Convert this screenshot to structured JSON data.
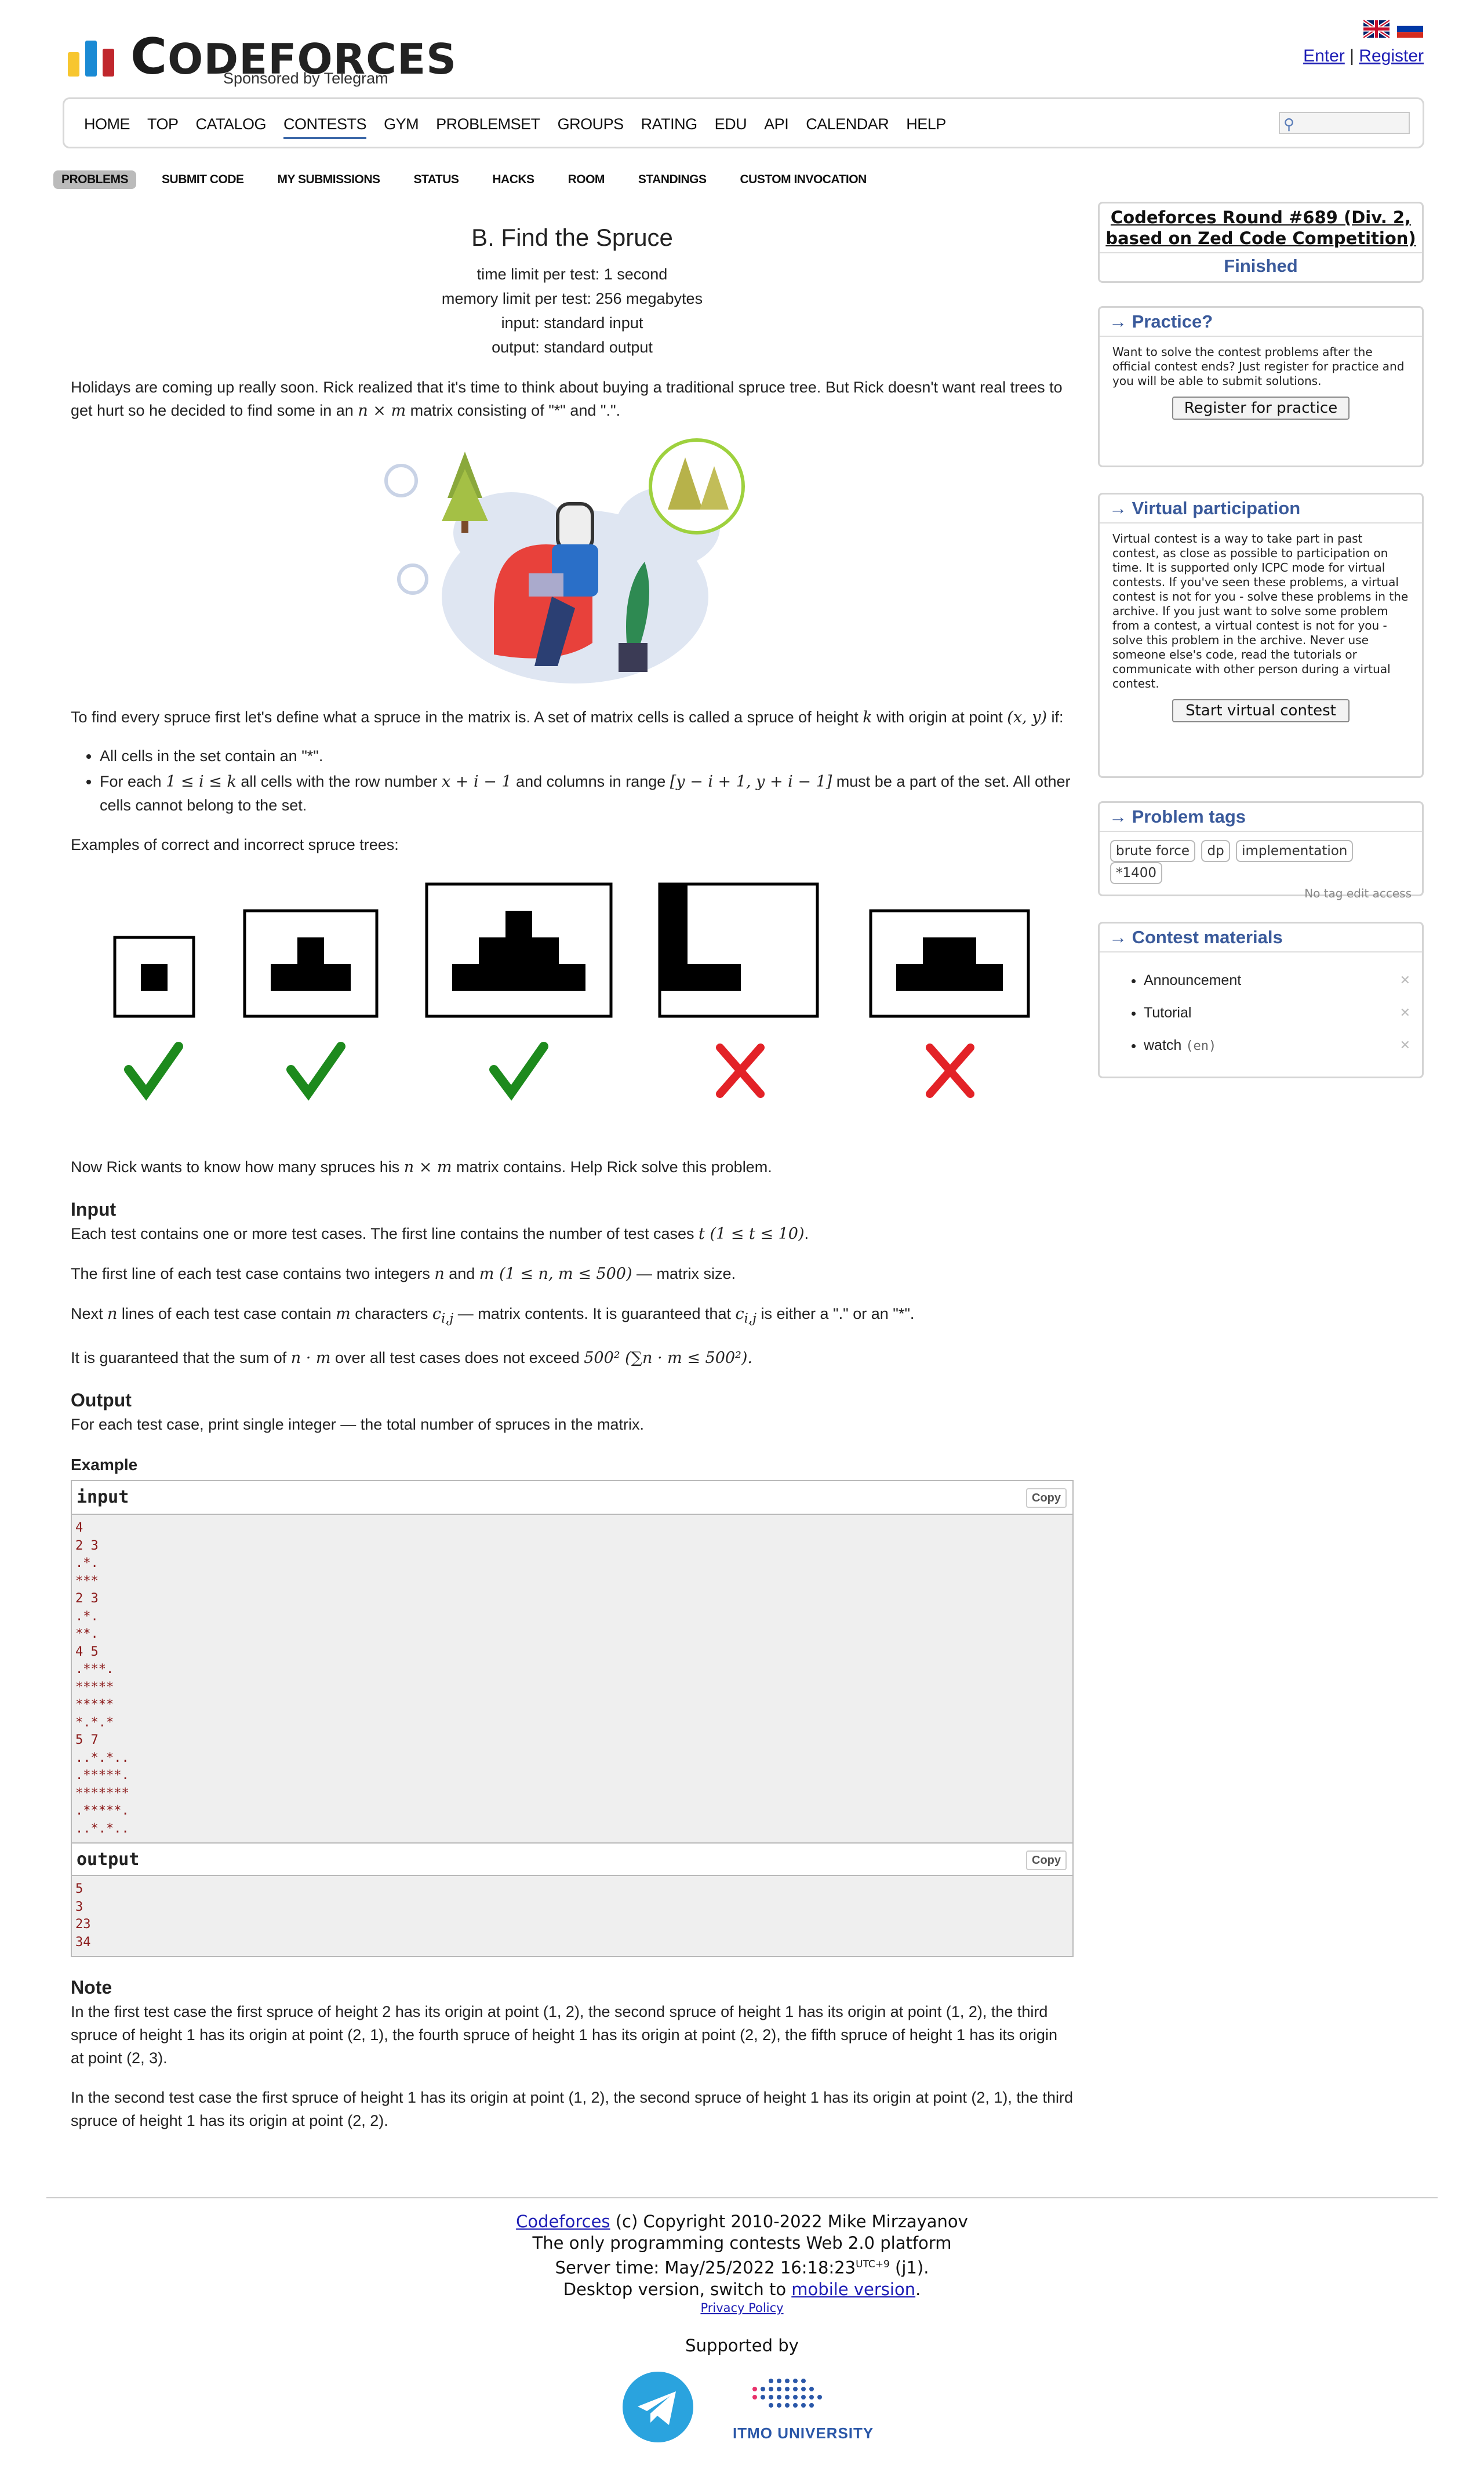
{
  "brand": {
    "name_c": "C",
    "name_rest": "ODEFORCES",
    "sponsor": "Sponsored by Telegram",
    "colors": {
      "bar_yellow": "#f7c62f",
      "bar_blue": "#1a8ad4",
      "bar_red": "#c0272d"
    }
  },
  "auth": {
    "enter": "Enter",
    "sep": "|",
    "register": "Register"
  },
  "menu": [
    "HOME",
    "TOP",
    "CATALOG",
    "CONTESTS",
    "GYM",
    "PROBLEMSET",
    "GROUPS",
    "RATING",
    "EDU",
    "API",
    "CALENDAR",
    "HELP"
  ],
  "menu_active": "CONTESTS",
  "submenu": [
    "PROBLEMS",
    "SUBMIT CODE",
    "MY SUBMISSIONS",
    "STATUS",
    "HACKS",
    "ROOM",
    "STANDINGS",
    "CUSTOM INVOCATION"
  ],
  "submenu_active": "PROBLEMS",
  "problem": {
    "title": "B. Find the Spruce",
    "time_limit": "time limit per test: 1 second",
    "memory_limit": "memory limit per test: 256 megabytes",
    "input": "input: standard input",
    "output": "output: standard output",
    "p1a": "Holidays are coming up really soon. Rick realized that it's time to think about buying a traditional spruce tree. But Rick doesn't want real trees to get hurt so he decided to find some in an ",
    "p1m": "n × m",
    "p1b": " matrix consisting of \"*\" and \".\".",
    "p2a": "To find every spruce first let's define what a spruce in the matrix is. A set of matrix cells is called a spruce of height ",
    "p2k": "k",
    "p2b": " with origin at point ",
    "p2xy": "(x, y)",
    "p2c": " if:",
    "b1": "All cells in the set contain an \"*\".",
    "b2a": "For each ",
    "b2m1": "1 ≤ i ≤ k",
    "b2b": " all cells with the row number ",
    "b2m2": "x + i − 1",
    "b2c": " and columns in range ",
    "b2m3": "[y − i + 1, y + i − 1]",
    "b2d": " must be a part of the set. All other cells cannot belong to the set.",
    "examples_intro": "Examples of correct and incorrect spruce trees:",
    "p3a": "Now Rick wants to know how many spruces his ",
    "p3m": "n × m",
    "p3b": " matrix contains. Help Rick solve this problem.",
    "input_title": "Input",
    "in1a": "Each test contains one or more test cases. The first line contains the number of test cases ",
    "in1m": "t (1 ≤ t ≤ 10)",
    "in1b": ".",
    "in2a": "The first line of each test case contains two integers ",
    "in2n": "n",
    "in2and": " and ",
    "in2m": "m",
    "in2r": " (1 ≤ n, m ≤ 500)",
    "in2b": " — matrix size.",
    "in3a": "Next ",
    "in3n": "n",
    "in3b": " lines of each test case contain ",
    "in3m": "m",
    "in3c": " characters ",
    "in3cij": "c",
    "in3sub": "i,j",
    "in3d": " — matrix contents. It is guaranteed that ",
    "in3e": " is either a \".\" or an \"*\".",
    "in4a": "It is guaranteed that the sum of ",
    "in4m": "n · m",
    "in4b": " over all test cases does not exceed ",
    "in4c": "500²",
    "in4d": " (∑n · m ≤ 500²).",
    "output_title": "Output",
    "out1": "For each test case, print single integer — the total number of spruces in the matrix.",
    "example_title": "Example",
    "input_label": "input",
    "output_label": "output",
    "copy": "Copy",
    "example_input": "4\n2 3\n.*.\n***\n2 3\n.*.\n**.\n4 5\n.***.\n*****\n*****\n*.*.*\n5 7\n..*.*..\n.*****.\n*******\n.*****.\n..*.*..",
    "example_output": "5\n3\n23\n34",
    "note_title": "Note",
    "note1": "In the first test case the first spruce of height 2 has its origin at point (1, 2), the second spruce of height 1 has its origin at point (1, 2), the third spruce of height 1 has its origin at point (2, 1), the fourth spruce of height 1 has its origin at point (2, 2), the fifth spruce of height 1 has its origin at point (2, 3).",
    "note2": "In the second test case the first spruce of height 1 has its origin at point (1, 2), the second spruce of height 1 has its origin at point (2, 1), the third spruce of height 1 has its origin at point (2, 2)."
  },
  "sidebar": {
    "contest_title": "Codeforces Round #689 (Div. 2, based on Zed Code Competition)",
    "contest_status": "Finished",
    "practice_title": "→ Practice?",
    "practice_text": "Want to solve the contest problems after the official contest ends? Just register for practice and you will be able to submit solutions.",
    "practice_button": "Register for practice",
    "virtual_title": "→ Virtual participation",
    "virtual_text": "Virtual contest is a way to take part in past contest, as close as possible to participation on time. It is supported only ICPC mode for virtual contests. If you've seen these problems, a virtual contest is not for you - solve these problems in the archive. If you just want to solve some problem from a contest, a virtual contest is not for you - solve this problem in the archive. Never use someone else's code, read the tutorials or communicate with other person during a virtual contest.",
    "virtual_button": "Start virtual contest",
    "tags_title": "→ Problem tags",
    "tags": [
      "brute force",
      "dp",
      "implementation",
      "*1400"
    ],
    "tags_note": "No tag edit access",
    "materials_title": "→ Contest materials",
    "materials": [
      "Announcement",
      "Tutorial",
      "watch"
    ],
    "materials_lang": "(en)"
  },
  "footer": {
    "cf": "Codeforces",
    "copyright": " (c) Copyright 2010-2022 Mike Mirzayanov",
    "line2": "The only programming contests Web 2.0 platform",
    "server_a": "Server time: May/25/2022 16:18:23",
    "server_sup": "UTC+9",
    "server_b": " (j1).",
    "desktop_a": "Desktop version, switch to ",
    "mobile": "mobile version",
    "desktop_b": ".",
    "privacy": "Privacy Policy",
    "supported": "Supported by",
    "itmo": "ITMO UNIVERSITY"
  }
}
